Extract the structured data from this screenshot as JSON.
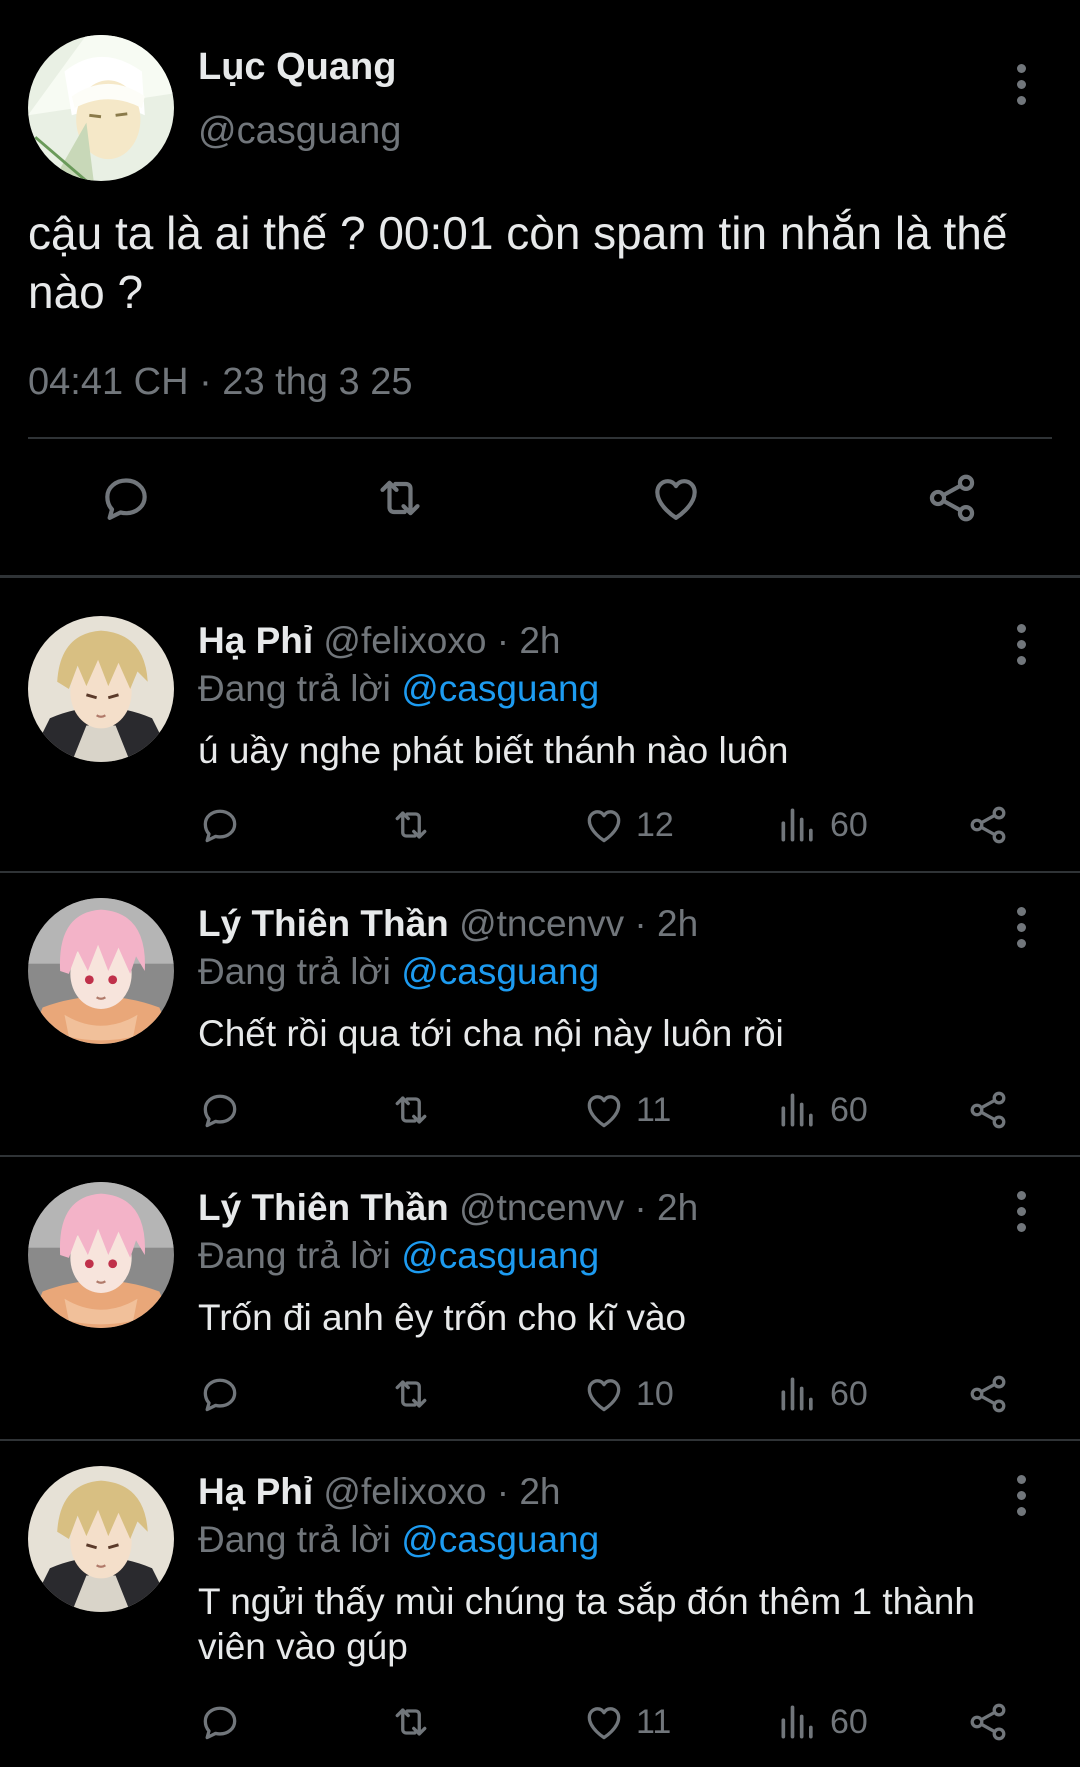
{
  "main_tweet": {
    "author_name": "Lục Quang",
    "author_handle": "@casguang",
    "text": "cậu ta là ai thế ? 00:01 còn spam tin nhắn là thế nào ?",
    "timestamp": "04:41 CH · 23 thg 3 25",
    "icons": [
      "reply-icon",
      "retweet-icon",
      "like-icon",
      "share-icon"
    ]
  },
  "replies": [
    {
      "name": "Hạ Phỉ",
      "handle": "@felixoxo",
      "dot": "·",
      "time": "2h",
      "replying_prefix": "Đang trả lời",
      "replying_to": "@casguang",
      "text": "ú uầy nghe phát biết thánh nào luôn",
      "likes": "12",
      "views": "60",
      "avatar": "blonde-hair"
    },
    {
      "name": "Lý Thiên Thần",
      "handle": "@tncenvv",
      "dot": "·",
      "time": "2h",
      "replying_prefix": "Đang trả lời",
      "replying_to": "@casguang",
      "text": "Chết rồi qua tới cha nội này luôn rồi",
      "likes": "11",
      "views": "60",
      "avatar": "pink-hair"
    },
    {
      "name": "Lý Thiên Thần",
      "handle": "@tncenvv",
      "dot": "·",
      "time": "2h",
      "replying_prefix": "Đang trả lời",
      "replying_to": "@casguang",
      "text": "Trốn đi anh êy trốn cho kĩ vào",
      "likes": "10",
      "views": "60",
      "avatar": "pink-hair"
    },
    {
      "name": "Hạ Phỉ",
      "handle": "@felixoxo",
      "dot": "·",
      "time": "2h",
      "replying_prefix": "Đang trả lời",
      "replying_to": "@casguang",
      "text": "T ngửi thấy mùi chúng ta sắp đón thêm 1 thành viên vào gúp",
      "likes": "11",
      "views": "60",
      "avatar": "blonde-hair"
    }
  ],
  "colors": {
    "background": "#000000",
    "text": "#e7e9ea",
    "muted": "#71767b",
    "accent": "#1d9bf0",
    "divider": "#2f3336"
  }
}
